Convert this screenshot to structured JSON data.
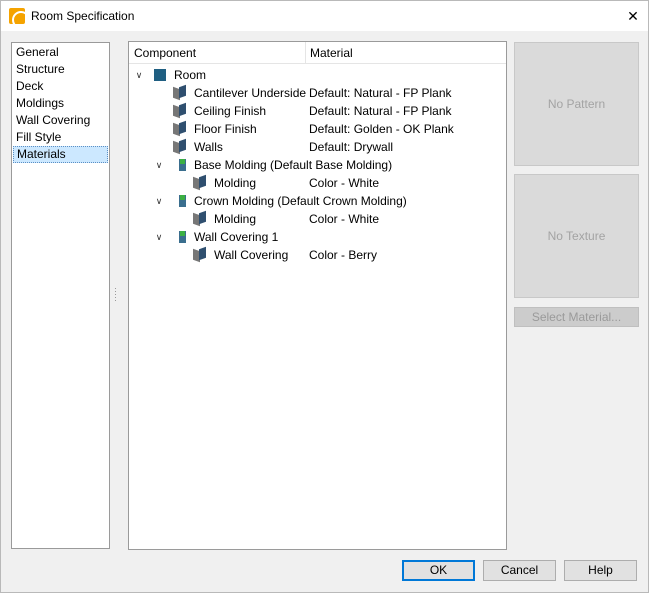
{
  "window": {
    "title": "Room Specification",
    "close_glyph": "✕"
  },
  "categories": [
    {
      "label": "General"
    },
    {
      "label": "Structure"
    },
    {
      "label": "Deck"
    },
    {
      "label": "Moldings"
    },
    {
      "label": "Wall Covering"
    },
    {
      "label": "Fill Style"
    },
    {
      "label": "Materials",
      "selected": true
    }
  ],
  "tree": {
    "headers": {
      "component": "Component",
      "material": "Material"
    },
    "rows": [
      {
        "component": "Room",
        "material": "",
        "icon": "room-icon"
      },
      {
        "component": "Cantilever Underside",
        "material": "Default: Natural - FP Plank",
        "icon": "material-icon"
      },
      {
        "component": "Ceiling Finish",
        "material": "Default: Natural - FP Plank",
        "icon": "material-icon"
      },
      {
        "component": "Floor Finish",
        "material": "Default: Golden - OK Plank",
        "icon": "material-icon"
      },
      {
        "component": "Walls",
        "material": "Default: Drywall",
        "icon": "material-icon"
      },
      {
        "component": "Base Molding (Default Base Molding)",
        "material": "",
        "icon": "molding-icon"
      },
      {
        "component": "Molding",
        "material": "Color - White",
        "icon": "material-icon"
      },
      {
        "component": "Crown Molding (Default Crown Molding)",
        "material": "",
        "icon": "molding-icon"
      },
      {
        "component": "Molding",
        "material": "Color - White",
        "icon": "material-icon"
      },
      {
        "component": "Wall Covering 1",
        "material": "",
        "icon": "molding-icon"
      },
      {
        "component": "Wall Covering",
        "material": "Color - Berry",
        "icon": "material-icon"
      }
    ]
  },
  "preview": {
    "pattern_text": "No Pattern",
    "texture_text": "No Texture",
    "select_material_label": "Select Material..."
  },
  "buttons": {
    "ok": "OK",
    "cancel": "Cancel",
    "help": "Help"
  },
  "colors": {
    "selection": "#cce8ff",
    "default_button_border": "#0078d7"
  }
}
